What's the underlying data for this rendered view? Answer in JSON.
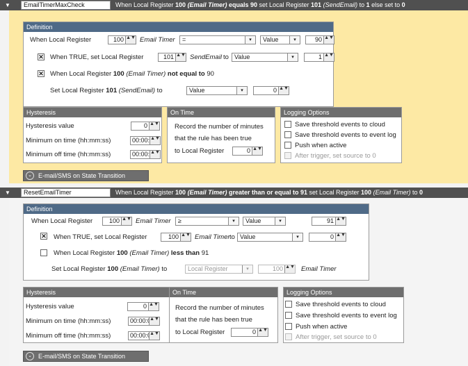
{
  "rules": [
    {
      "name": "EmailTimerMaxCheck",
      "summary_pre": "When Local Register ",
      "summary_reg": "100",
      "summary_regname": "(Email Timer)",
      "summary_mid": " equals ",
      "summary_val": "90",
      "summary_post": " set Local Register ",
      "summary_reg2": "101",
      "summary_reg2name": "(SendEmail)",
      "summary_tail": " to ",
      "summary_setval": "1",
      "summary_end": " else set to ",
      "summary_elseval": "0",
      "definition": {
        "title": "Definition",
        "when_label": "When Local Register",
        "register": "100",
        "register_name": "Email Timer",
        "operator": "=",
        "value_type": "Value",
        "threshold": "90",
        "true_label": "When TRUE, set Local Register",
        "true_register": "101",
        "true_register_name": "SendEmail",
        "to_label": "to",
        "true_value_type": "Value",
        "true_value": "1",
        "false_pre": "When Local Register ",
        "false_reg": "100",
        "false_regname": "(Email Timer)",
        "false_cond": "not equal to",
        "false_val": "90",
        "else_pre": "Set Local Register ",
        "else_reg": "101",
        "else_regname": "(SendEmail)",
        "else_to": " to",
        "else_value_type": "Value",
        "else_value": "0"
      },
      "hysteresis": {
        "title": "Hysteresis",
        "value_label": "Hysteresis value",
        "value": "0",
        "on_label": "Minimum on time (hh:mm:ss)",
        "on": "00:00:00",
        "off_label": "Minimum off time (hh:mm:ss)",
        "off": "00:00:00"
      },
      "ontime": {
        "title": "On Time",
        "line1": "Record the number of minutes",
        "line2": "that the rule has been true",
        "line3": "to Local Register",
        "register": "0"
      },
      "logging": {
        "title": "Logging Options",
        "opt1": "Save threshold events to cloud",
        "opt2": "Save threshold events to event log",
        "opt3": "Push when active",
        "opt4": "After trigger, set source to 0"
      },
      "transition": "E-mail/SMS on State Transition"
    },
    {
      "name": "ResetEmailTimer",
      "summary_pre": "When Local Register ",
      "summary_reg": "100",
      "summary_regname": "(Email Timer)",
      "summary_mid": " greater than or equal to ",
      "summary_val": "91",
      "summary_post": " set Local Register ",
      "summary_reg2": "100",
      "summary_reg2name": "(Email Timer)",
      "summary_tail": " to ",
      "summary_setval": "0",
      "definition": {
        "title": "Definition",
        "when_label": "When Local Register",
        "register": "100",
        "register_name": "Email Timer",
        "operator": "≥",
        "value_type": "Value",
        "threshold": "91",
        "true_label": "When TRUE, set Local Register",
        "true_register": "100",
        "true_register_name": "Email Timer",
        "to_label": "to",
        "true_value_type": "Value",
        "true_value": "0",
        "false_pre": "When Local Register ",
        "false_reg": "100",
        "false_regname": "(Email Timer)",
        "false_cond": "less than",
        "false_val": "91",
        "else_pre": "Set Local Register ",
        "else_reg": "100",
        "else_regname": "(Email Timer)",
        "else_to": " to",
        "else_value_type": "Local Register",
        "else_value": "100",
        "else_value_name": "Email Timer"
      },
      "hysteresis": {
        "title": "Hysteresis",
        "value_label": "Hysteresis value",
        "value": "0",
        "on_label": "Minimum on time (hh:mm:ss)",
        "on": "00:00:00",
        "off_label": "Minimum off time (hh:mm:ss)",
        "off": "00:00:00"
      },
      "ontime": {
        "title": "On Time",
        "line1": "Record the number of minutes",
        "line2": "that the rule has been true",
        "line3": "to Local Register",
        "register": "0"
      },
      "logging": {
        "title": "Logging Options",
        "opt1": "Save threshold events to cloud",
        "opt2": "Save threshold events to event log",
        "opt3": "Push when active",
        "opt4": "After trigger, set source to 0"
      },
      "transition": "E-mail/SMS on State Transition"
    }
  ],
  "glyphs": {
    "spin": "▲▼",
    "arrow": "▾",
    "collapse": "▼",
    "checked": "✕",
    "circle_chev": "⌄"
  },
  "colors": {
    "header": "#505050",
    "active_rule_bg": "#fde9a4",
    "panel_header": "#6e6e6e",
    "definition_header": "#4f6a87"
  }
}
